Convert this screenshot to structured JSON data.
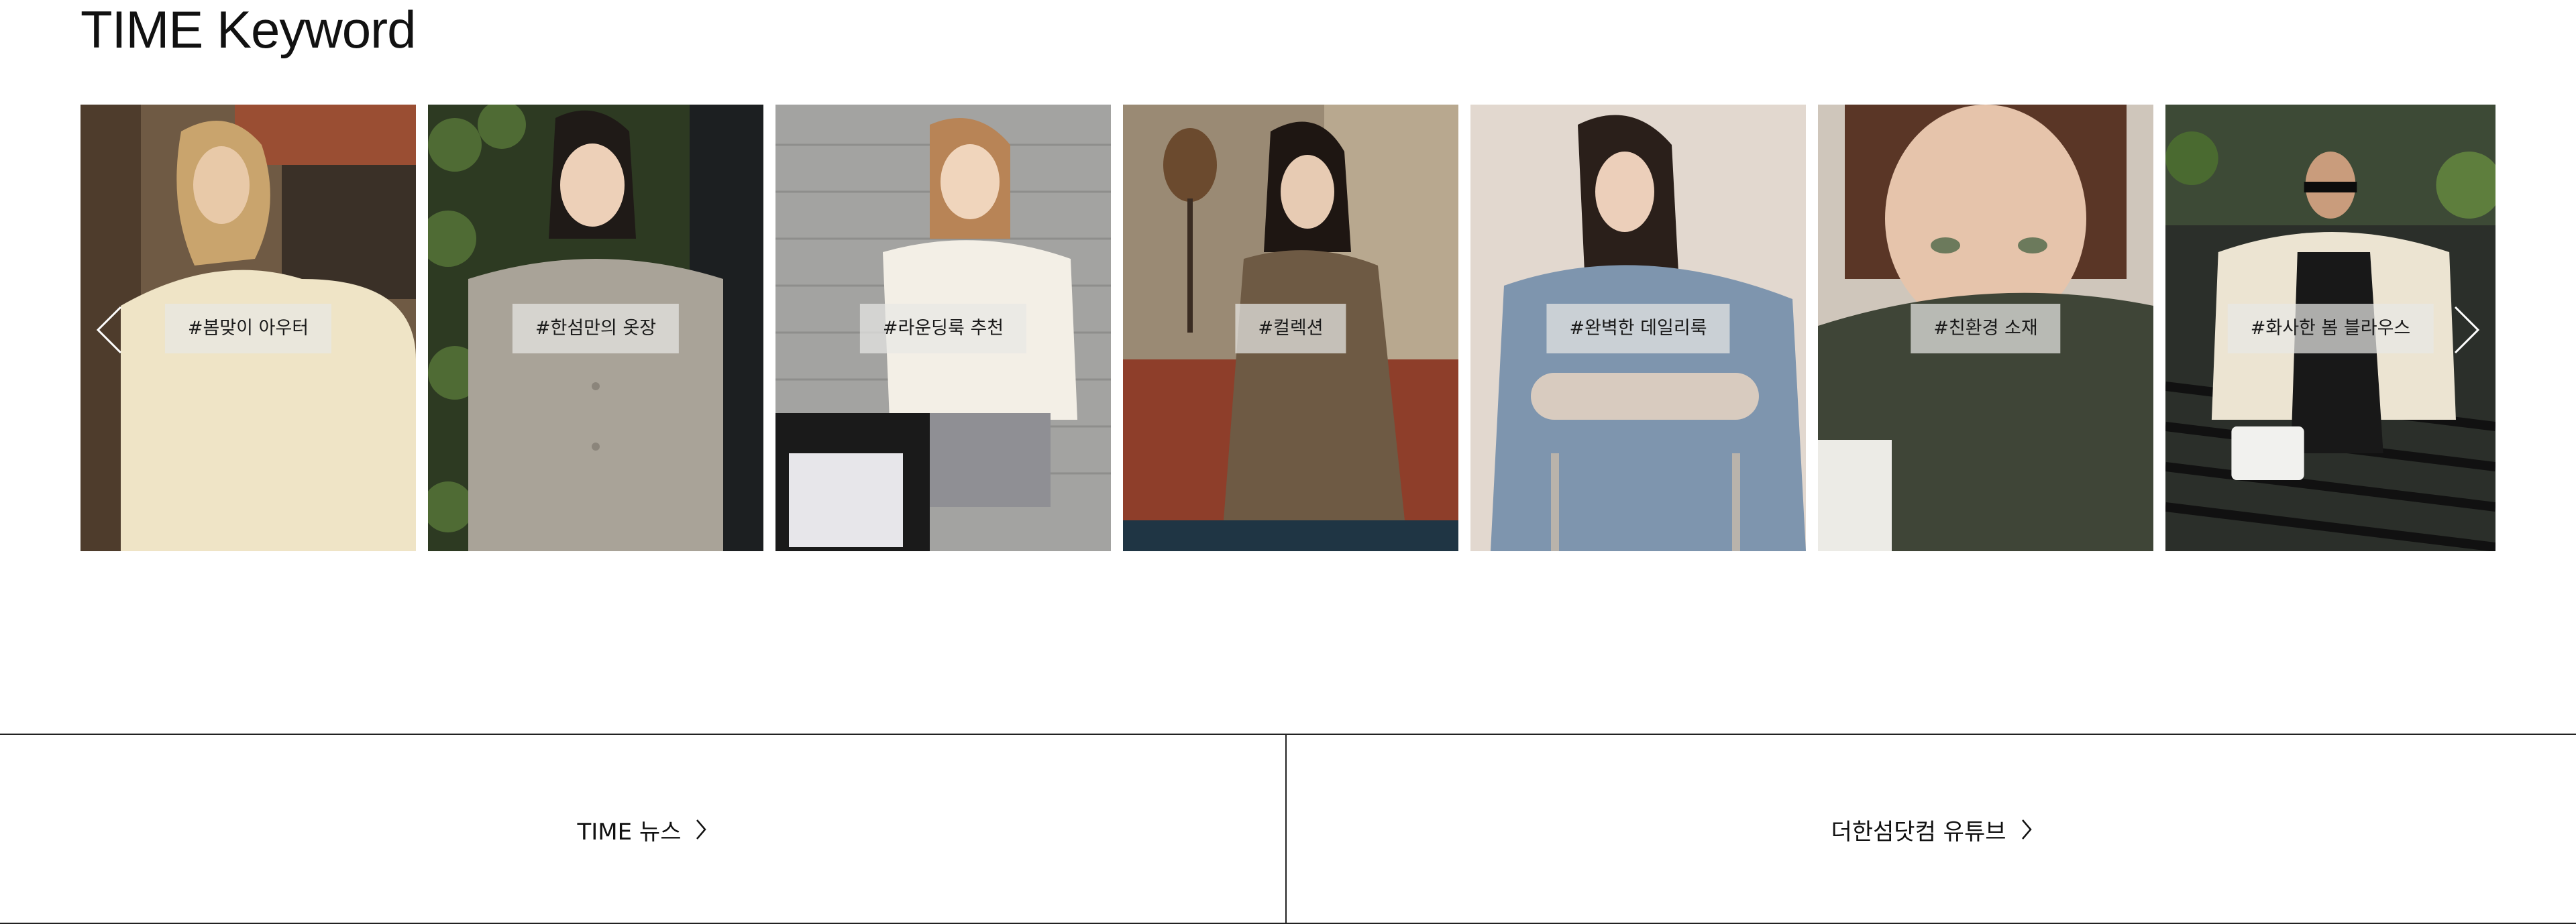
{
  "section": {
    "title": "TIME Keyword"
  },
  "keywords": [
    {
      "tag": "#봄맞이 아우터",
      "image": "woman-cream-blouse-photo"
    },
    {
      "tag": "#한섬만의 옷장",
      "image": "woman-tweed-jacket-photo"
    },
    {
      "tag": "#라운딩룩 추천",
      "image": "woman-golf-bag-photo"
    },
    {
      "tag": "#컬렉션",
      "image": "woman-brown-sofa-photo"
    },
    {
      "tag": "#완벽한 데일리룩",
      "image": "woman-denim-chair-photo"
    },
    {
      "tag": "#친환경 소재",
      "image": "woman-green-turtleneck-photo"
    },
    {
      "tag": "#화사한 봄 블라우스",
      "image": "woman-white-blazer-photo"
    }
  ],
  "navigation": {
    "prev_icon": "chevron-left-icon",
    "next_icon": "chevron-right-icon"
  },
  "bottom_links": [
    {
      "label": "TIME 뉴스"
    },
    {
      "label": "더한섬닷컴 유튜브"
    }
  ]
}
